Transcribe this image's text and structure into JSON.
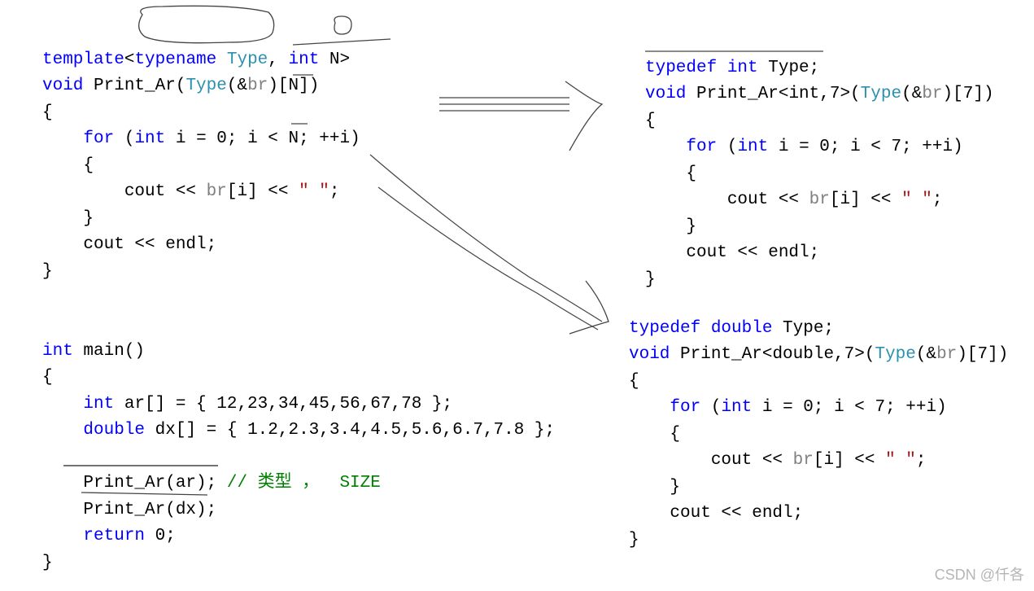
{
  "watermark": "CSDN @仟各",
  "template_block": {
    "l1a": "template",
    "l1b": "<",
    "l1c": "typename",
    "l1d": " ",
    "l1e": "Type",
    "l1f": ", ",
    "l1g": "int",
    "l1h": " N>",
    "l2a": "void",
    "l2b": " Print_Ar(",
    "l2c": "Type",
    "l2d": "(&",
    "l2e": "br",
    "l2f": ")[N])",
    "l3": "{",
    "l4a": "    ",
    "l4b": "for",
    "l4c": " (",
    "l4d": "int",
    "l4e": " i = 0; i < N; ++i)",
    "l5": "    {",
    "l6a": "        cout << ",
    "l6b": "br",
    "l6c": "[i] << ",
    "l6d": "\" \"",
    "l6e": ";",
    "l7": "    }",
    "l8": "    cout << endl;",
    "l9": "}"
  },
  "main_block": {
    "l1a": "int",
    "l1b": " main()",
    "l2": "{",
    "l3a": "    ",
    "l3b": "int",
    "l3c": " ar[] = { 12,23,34,45,56,67,78 };",
    "l4a": "    ",
    "l4b": "double",
    "l4c": " dx[] = { 1.2,2.3,3.4,4.5,5.6,6.7,7.8 };",
    "l5": "",
    "l6a": "    Print_Ar(ar); ",
    "l6b": "// 类型 ，  SIZE",
    "l7": "    Print_Ar(dx);",
    "l8a": "    ",
    "l8b": "return",
    "l8c": " 0;",
    "l9": "}"
  },
  "int_block": {
    "l1a": "typedef",
    "l1b": " ",
    "l1c": "int",
    "l1d": " Type;",
    "l2a": "void",
    "l2b": " Print_Ar<int,7>(",
    "l2c": "Type",
    "l2d": "(&",
    "l2e": "br",
    "l2f": ")[7])",
    "l3": "{",
    "l4a": "    ",
    "l4b": "for",
    "l4c": " (",
    "l4d": "int",
    "l4e": " i = 0; i < 7; ++i)",
    "l5": "    {",
    "l6a": "        cout << ",
    "l6b": "br",
    "l6c": "[i] << ",
    "l6d": "\" \"",
    "l6e": ";",
    "l7": "    }",
    "l8": "    cout << endl;",
    "l9": "}"
  },
  "double_block": {
    "l1a": "typedef",
    "l1b": " ",
    "l1c": "double",
    "l1d": " Type;",
    "l2a": "void",
    "l2b": " Print_Ar<double,7>(",
    "l2c": "Type",
    "l2d": "(&",
    "l2e": "br",
    "l2f": ")[7])",
    "l3": "{",
    "l4a": "    ",
    "l4b": "for",
    "l4c": " (",
    "l4d": "int",
    "l4e": " i = 0; i < 7; ++i)",
    "l5": "    {",
    "l6a": "        cout << ",
    "l6b": "br",
    "l6c": "[i] << ",
    "l6d": "\" \"",
    "l6e": ";",
    "l7": "    }",
    "l8": "    cout << endl;",
    "l9": "}"
  }
}
